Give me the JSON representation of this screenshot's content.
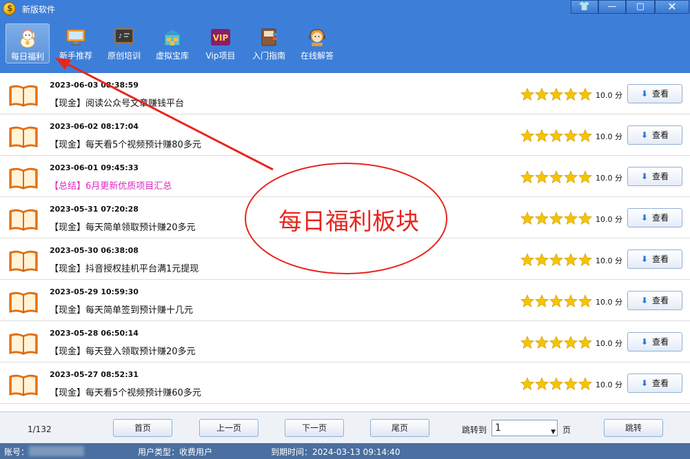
{
  "app": {
    "title": "新版软件"
  },
  "window_buttons": {
    "skin": "👕",
    "minimize": "—",
    "maximize": "▢",
    "close": "✕"
  },
  "toolbar": [
    {
      "label": "每日福利",
      "icon": "lucky-cat-icon"
    },
    {
      "label": "新手推荐",
      "icon": "monitor-icon"
    },
    {
      "label": "原创培训",
      "icon": "blackboard-icon"
    },
    {
      "label": "虚拟宝库",
      "icon": "warehouse-icon"
    },
    {
      "label": "Vip项目",
      "icon": "vip-icon"
    },
    {
      "label": "入门指南",
      "icon": "guide-book-icon"
    },
    {
      "label": "在线解答",
      "icon": "support-agent-icon"
    }
  ],
  "list": [
    {
      "date": "2023-06-03 08:38:59",
      "title": "【现金】阅读公众号文章赚钱平台",
      "score": "10.0 分",
      "rating": 5,
      "highlight": false
    },
    {
      "date": "2023-06-02 08:17:04",
      "title": "【现金】每天看5个视频预计赚80多元",
      "score": "10.0 分",
      "rating": 5,
      "highlight": false
    },
    {
      "date": "2023-06-01 09:45:33",
      "title": "【总结】6月更新优质项目汇总",
      "score": "10.0 分",
      "rating": 5,
      "highlight": true
    },
    {
      "date": "2023-05-31 07:20:28",
      "title": "【现金】每天简单领取预计赚20多元",
      "score": "10.0 分",
      "rating": 5,
      "highlight": false
    },
    {
      "date": "2023-05-30 06:38:08",
      "title": "【现金】抖音授权挂机平台满1元提现",
      "score": "10.0 分",
      "rating": 5,
      "highlight": false
    },
    {
      "date": "2023-05-29 10:59:30",
      "title": "【现金】每天简单签到预计赚十几元",
      "score": "10.0 分",
      "rating": 5,
      "highlight": false
    },
    {
      "date": "2023-05-28 06:50:14",
      "title": "【现金】每天登入领取预计赚20多元",
      "score": "10.0 分",
      "rating": 5,
      "highlight": false
    },
    {
      "date": "2023-05-27 08:52:31",
      "title": "【现金】每天看5个视频预计赚60多元",
      "score": "10.0 分",
      "rating": 5,
      "highlight": false
    }
  ],
  "row_action": {
    "label": "查看",
    "icon": "download-arrow-icon"
  },
  "pagination": {
    "current": "1/132",
    "first": "首页",
    "prev": "上一页",
    "next": "下一页",
    "last": "尾页",
    "jump_label": "跳转到",
    "jump_value": "1",
    "page_unit": "页",
    "jump_button": "跳转"
  },
  "status": {
    "account_label": "账号：",
    "user_type": "用户类型：收费用户",
    "expire": "到期时间：2024-03-13 09:14:40"
  },
  "annotation": {
    "text": "每日福利板块",
    "color": "#e8251c"
  },
  "colors": {
    "titlebar": "#3d7fd8",
    "highlight_text": "#e026c2",
    "star": "#f5c400"
  }
}
